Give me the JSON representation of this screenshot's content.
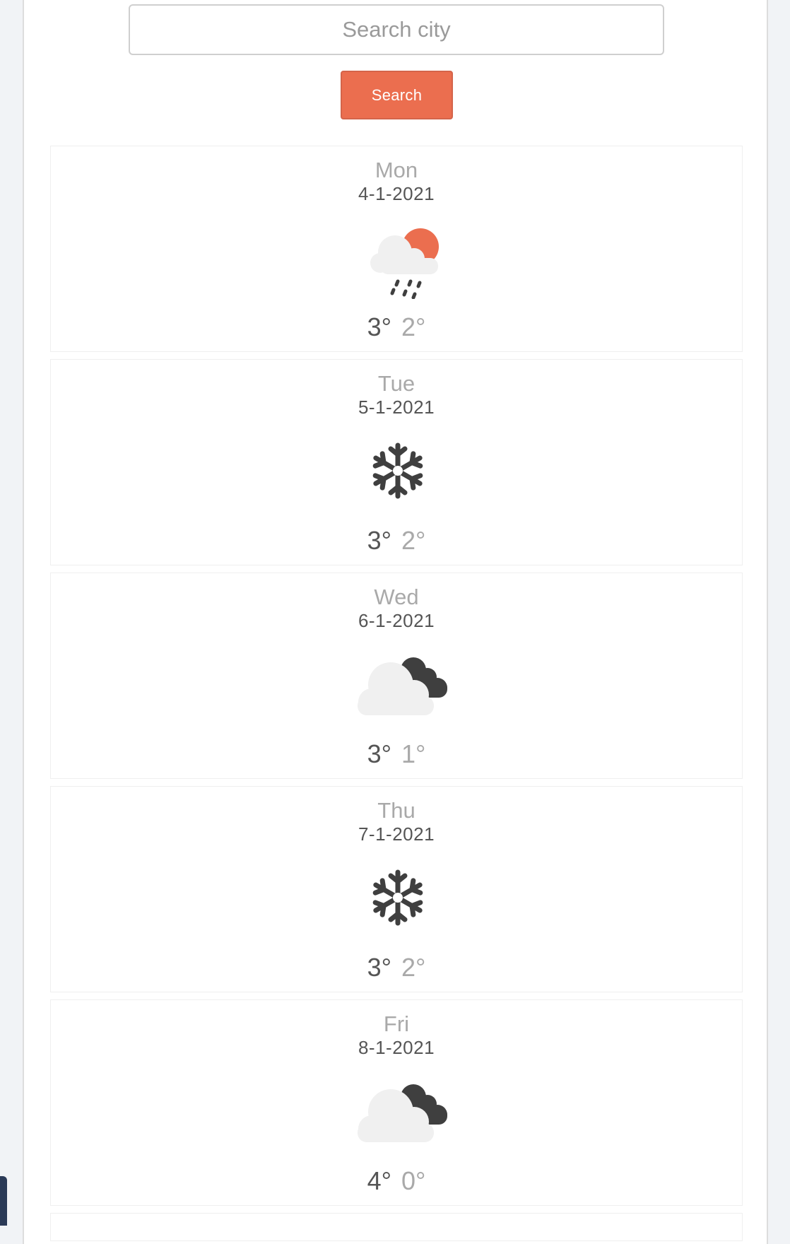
{
  "search": {
    "placeholder": "Search city",
    "value": "",
    "button_label": "Search"
  },
  "colors": {
    "accent": "#eb6e4f",
    "icon_dark": "#3f3f3f",
    "cloud_light": "#f0f0f0"
  },
  "forecast": [
    {
      "day": "Mon",
      "date": "4-1-2021",
      "icon": "sun-cloud-rain-icon",
      "max": "3°",
      "min": "2°"
    },
    {
      "day": "Tue",
      "date": "5-1-2021",
      "icon": "snowflake-icon",
      "max": "3°",
      "min": "2°"
    },
    {
      "day": "Wed",
      "date": "6-1-2021",
      "icon": "clouds-icon",
      "max": "3°",
      "min": "1°"
    },
    {
      "day": "Thu",
      "date": "7-1-2021",
      "icon": "snowflake-icon",
      "max": "3°",
      "min": "2°"
    },
    {
      "day": "Fri",
      "date": "8-1-2021",
      "icon": "clouds-icon",
      "max": "4°",
      "min": "0°"
    }
  ]
}
